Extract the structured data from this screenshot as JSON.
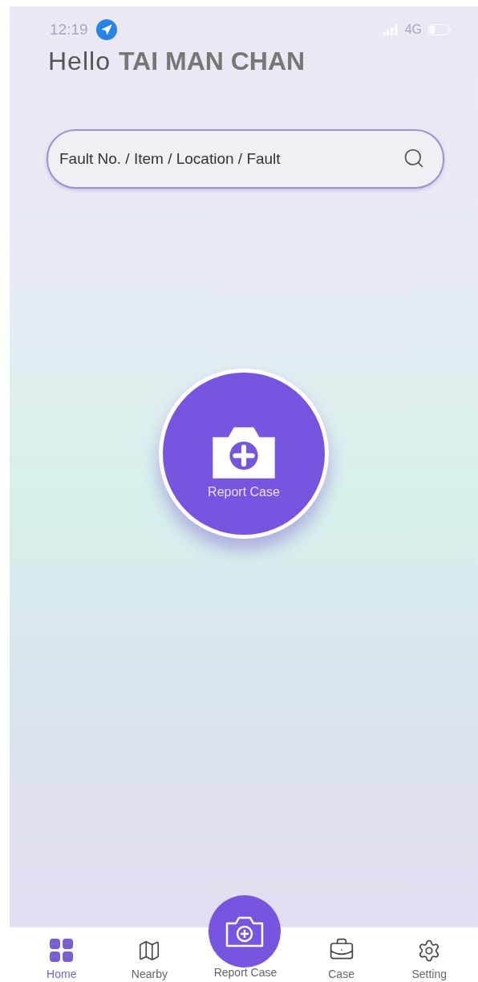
{
  "status_bar": {
    "time": "12:19",
    "network": "4G"
  },
  "greeting": {
    "salutation": "Hello",
    "name": "TAI MAN CHAN"
  },
  "search": {
    "placeholder": "Fault No. / Item / Location / Fault"
  },
  "main_action": {
    "label": "Report Case"
  },
  "nav": [
    {
      "kind": "tab",
      "label": "Home",
      "selected": true
    },
    {
      "kind": "tab",
      "label": "Nearby",
      "selected": false
    },
    {
      "kind": "center",
      "label": "Report Case",
      "selected": false
    },
    {
      "kind": "tab",
      "label": "Case",
      "selected": false
    },
    {
      "kind": "tab",
      "label": "Setting",
      "selected": false
    }
  ]
}
